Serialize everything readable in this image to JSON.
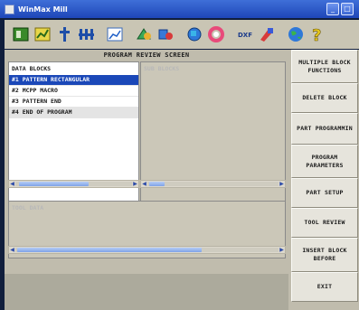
{
  "window": {
    "title": "WinMax Mill",
    "minimize_glyph": "_",
    "close_glyph": "□"
  },
  "toolbar": {
    "icons": [
      "program-icon",
      "chart-icon",
      "spindle-icon",
      "fixture-icon",
      "graph-icon",
      "tool-shapes-icon",
      "tool-shapes2-icon",
      "globe-cube-icon",
      "lifesaver-icon",
      "dxf-icon",
      "tool-set-icon",
      "globe-icon",
      "help-icon"
    ],
    "dxf_label": "DXF"
  },
  "screen": {
    "title": "PROGRAM REVIEW SCREEN"
  },
  "data_blocks": {
    "header": "DATA BLOCKS",
    "rows": [
      {
        "label": "#1 PATTERN RECTANGULAR",
        "selected": true
      },
      {
        "label": "#2 MCPP MACRO",
        "selected": false
      },
      {
        "label": "#3 PATTERN END",
        "selected": false
      },
      {
        "label": "#4 END OF PROGRAM",
        "selected": false
      }
    ]
  },
  "sub_blocks": {
    "header": "SUB BLOCKS"
  },
  "tool_data": {
    "header": "TOOL DATA"
  },
  "sidebar": {
    "buttons": [
      {
        "name": "multiple-block-functions-button",
        "label": "MULTIPLE BLOCK\nFUNCTIONS"
      },
      {
        "name": "delete-block-button",
        "label": "DELETE BLOCK"
      },
      {
        "name": "part-programming-button",
        "label": "PART PROGRAMMIN"
      },
      {
        "name": "program-parameters-button",
        "label": "PROGRAM\nPARAMETERS"
      },
      {
        "name": "part-setup-button",
        "label": "PART SETUP"
      },
      {
        "name": "tool-review-button",
        "label": "TOOL REVIEW"
      },
      {
        "name": "insert-block-before-button",
        "label": "INSERT BLOCK\nBEFORE"
      },
      {
        "name": "exit-button",
        "label": "EXIT"
      }
    ]
  },
  "colors": {
    "selection": "#1b48b8",
    "title_bar": "#2f5ed0",
    "panel": "#c0bcad"
  }
}
